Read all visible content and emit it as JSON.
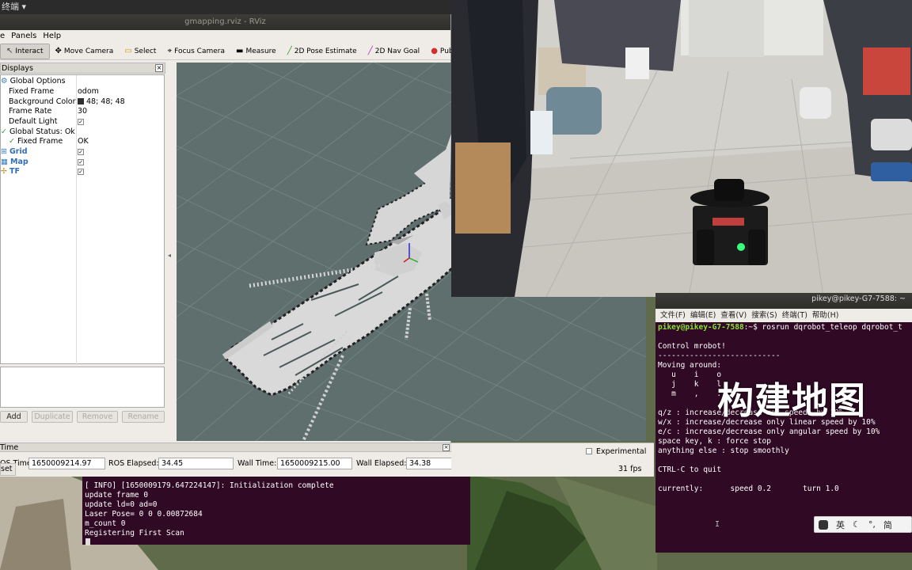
{
  "topbar": {
    "label": "终端"
  },
  "rviz": {
    "title": "gmapping.rviz - RViz",
    "menu": [
      "e",
      "Panels",
      "Help"
    ],
    "toolbar": [
      {
        "label": "Interact",
        "icon": "interact-icon"
      },
      {
        "label": "Move Camera",
        "icon": "move-camera-icon"
      },
      {
        "label": "Select",
        "icon": "select-icon"
      },
      {
        "label": "Focus Camera",
        "icon": "focus-camera-icon"
      },
      {
        "label": "Measure",
        "icon": "measure-icon"
      },
      {
        "label": "2D Pose Estimate",
        "icon": "pose-estimate-icon"
      },
      {
        "label": "2D Nav Goal",
        "icon": "nav-goal-icon"
      },
      {
        "label": "Publish Point",
        "icon": "publish-point-icon"
      }
    ],
    "displays": {
      "header": "Displays",
      "rows": [
        {
          "key": "Global Options",
          "value": ""
        },
        {
          "key": "Fixed Frame",
          "value": "odom"
        },
        {
          "key": "Background Color",
          "value": "48; 48; 48"
        },
        {
          "key": "Frame Rate",
          "value": "30"
        },
        {
          "key": "Default Light",
          "value": "✓"
        },
        {
          "key": "Global Status: Ok",
          "value": ""
        },
        {
          "key": "Fixed Frame",
          "value": "OK"
        },
        {
          "key": "Grid",
          "value": "✓"
        },
        {
          "key": "Map",
          "value": "✓"
        },
        {
          "key": "TF",
          "value": "✓"
        }
      ],
      "buttons": [
        "Add",
        "Duplicate",
        "Remove",
        "Rename"
      ]
    },
    "time": {
      "header": "Time",
      "ros_time_label": "OS Time:",
      "ros_time": "1650009214.97",
      "ros_elapsed_label": "ROS Elapsed:",
      "ros_elapsed": "34.45",
      "wall_time_label": "Wall Time:",
      "wall_time": "1650009215.00",
      "wall_elapsed_label": "Wall Elapsed:",
      "wall_elapsed": "34.38",
      "experimental": "Experimental",
      "reset": "set",
      "fps": "31 fps"
    }
  },
  "term_right": {
    "title": "pikey@pikey-G7-7588: ~",
    "menu": [
      "文件(F)",
      "编辑(E)",
      "查看(V)",
      "搜索(S)",
      "终端(T)",
      "帮助(H)"
    ],
    "prompt": "pikey@pikey-G7-7588",
    "command": ":~$ rosrun dqrobot_teleop dqrobot_t",
    "lines": [
      "Control mrobot!",
      "---------------------------",
      "Moving around:",
      "   u    i    o",
      "   j    k    l",
      "   m    ,    .",
      "",
      "q/z : increase/decrease max speeds by 10%",
      "w/x : increase/decrease only linear speed by 10%",
      "e/c : increase/decrease only angular speed by 10%",
      "space key, k : force stop",
      "anything else : stop smoothly",
      "",
      "CTRL-C to quit",
      "",
      "currently:      speed 0.2       turn 1.0"
    ]
  },
  "overlay_text": "构建地图",
  "ime": [
    "英",
    "简"
  ],
  "term_left": {
    "lines": [
      "[ INFO] [1650009179.647224147]: Initialization complete",
      "update frame 0",
      "update ld=0 ad=0",
      "Laser Pose= 0 0 0.00872684",
      "m_count 0",
      "Registering First Scan"
    ]
  }
}
